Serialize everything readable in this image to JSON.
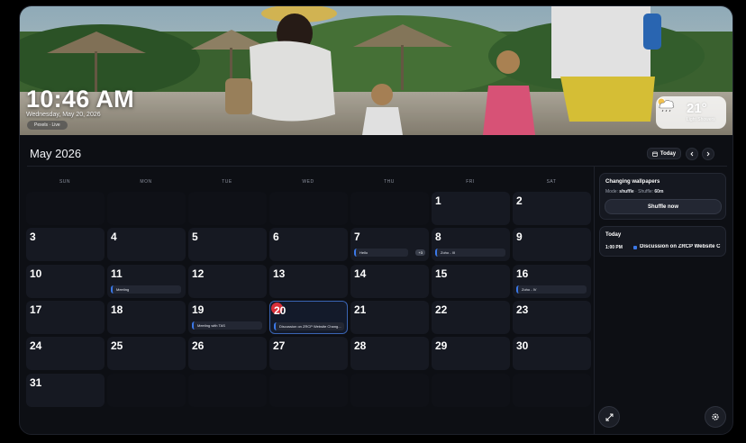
{
  "hero": {
    "time": "10:46 AM",
    "date": "Wednesday, May 20, 2026",
    "source_pill": "Pexels · Live",
    "weather": {
      "temp": "21°",
      "condition": "Light Showers",
      "icon": "cloud-rain-icon"
    }
  },
  "calendar": {
    "month_title": "May 2026",
    "today_label": "Today",
    "weekdays": [
      "SUN",
      "MON",
      "TUE",
      "WED",
      "THU",
      "FRI",
      "SAT"
    ],
    "days": [
      {
        "n": "1"
      },
      {
        "n": "2"
      },
      {
        "n": "3"
      },
      {
        "n": "4"
      },
      {
        "n": "5"
      },
      {
        "n": "6"
      },
      {
        "n": "7",
        "event": "Hello",
        "more": "+3"
      },
      {
        "n": "8",
        "event": "Zoho - III"
      },
      {
        "n": "9"
      },
      {
        "n": "10"
      },
      {
        "n": "11",
        "event": "Meeting"
      },
      {
        "n": "12"
      },
      {
        "n": "13"
      },
      {
        "n": "14"
      },
      {
        "n": "15"
      },
      {
        "n": "16",
        "event": "Zoho - IV"
      },
      {
        "n": "17"
      },
      {
        "n": "18"
      },
      {
        "n": "19",
        "event": "Meeting with TAS"
      },
      {
        "n": "20",
        "event": "Discussion on ZRCP Website Chang..."
      },
      {
        "n": "21"
      },
      {
        "n": "22"
      },
      {
        "n": "23"
      },
      {
        "n": "24"
      },
      {
        "n": "25"
      },
      {
        "n": "26"
      },
      {
        "n": "27"
      },
      {
        "n": "28"
      },
      {
        "n": "29"
      },
      {
        "n": "30"
      },
      {
        "n": "31"
      }
    ]
  },
  "sidebar": {
    "wallpaper": {
      "title": "Changing wallpapers",
      "mode_label": "Mode:",
      "mode_value": "shuffle",
      "sep": " · ",
      "shuffle_label": "Shuffle:",
      "shuffle_value": "60m",
      "button": "Shuffle now"
    },
    "today": {
      "title": "Today",
      "items": [
        {
          "time": "1:00 PM",
          "title": "Discussion on ZRCP Website C"
        }
      ]
    }
  },
  "colors": {
    "accent": "#3b78e7",
    "today_marker": "#d8303a",
    "background": "#0d0f14"
  }
}
